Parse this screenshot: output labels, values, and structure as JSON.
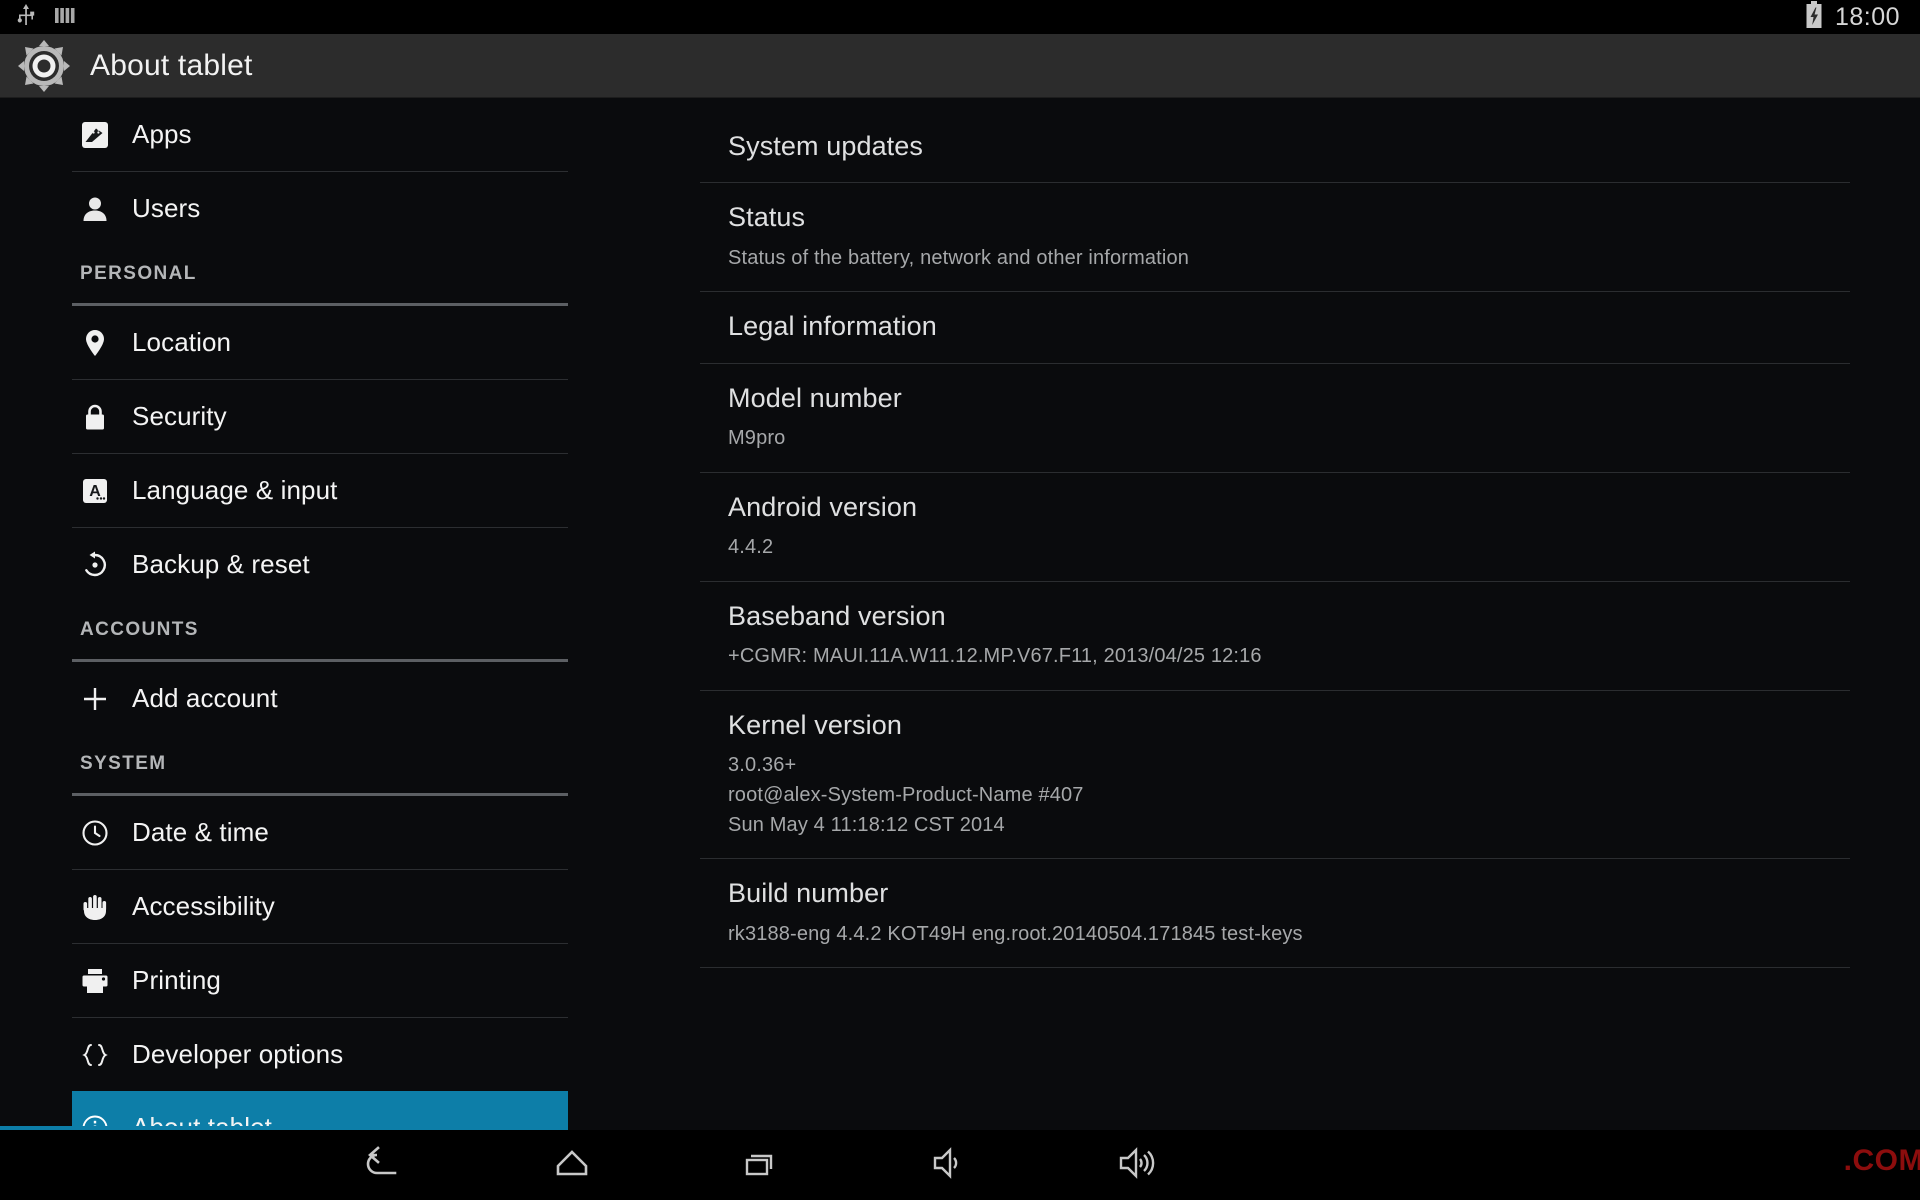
{
  "colors": {
    "accent": "#0d7ea8",
    "background": "#0a0b0d",
    "actionbar": "#2c2c2c",
    "statusbar": "#000000",
    "divider": "#2b2d30",
    "section_divider": "#5c5f63",
    "text_primary": "#f2f2f2",
    "text_secondary": "#a6a8aa",
    "watermark": "#8c0d0d"
  },
  "statusbar": {
    "left_icons": [
      "usb-icon",
      "signal-bars-icon"
    ],
    "right_icons": [
      "battery-charging-icon"
    ],
    "clock": "18:00"
  },
  "actionbar": {
    "icon": "settings-gear-icon",
    "title": "About tablet"
  },
  "sidebar": {
    "items": [
      {
        "type": "item",
        "label": "Apps",
        "icon": "apps-android-icon",
        "selected": false
      },
      {
        "type": "divider"
      },
      {
        "type": "item",
        "label": "Users",
        "icon": "user-person-icon",
        "selected": false
      },
      {
        "type": "section",
        "label": "PERSONAL"
      },
      {
        "type": "item",
        "label": "Location",
        "icon": "location-pin-icon",
        "selected": false
      },
      {
        "type": "divider"
      },
      {
        "type": "item",
        "label": "Security",
        "icon": "lock-icon",
        "selected": false
      },
      {
        "type": "divider"
      },
      {
        "type": "item",
        "label": "Language & input",
        "icon": "language-keyboard-icon",
        "selected": false
      },
      {
        "type": "divider"
      },
      {
        "type": "item",
        "label": "Backup & reset",
        "icon": "backup-restore-icon",
        "selected": false
      },
      {
        "type": "section",
        "label": "ACCOUNTS"
      },
      {
        "type": "item",
        "label": "Add account",
        "icon": "plus-icon",
        "selected": false
      },
      {
        "type": "section",
        "label": "SYSTEM"
      },
      {
        "type": "item",
        "label": "Date & time",
        "icon": "clock-icon",
        "selected": false
      },
      {
        "type": "divider"
      },
      {
        "type": "item",
        "label": "Accessibility",
        "icon": "hand-icon",
        "selected": false
      },
      {
        "type": "divider"
      },
      {
        "type": "item",
        "label": "Printing",
        "icon": "printer-icon",
        "selected": false
      },
      {
        "type": "divider"
      },
      {
        "type": "item",
        "label": "Developer options",
        "icon": "braces-icon",
        "selected": false
      },
      {
        "type": "item",
        "label": "About tablet",
        "icon": "info-circle-icon",
        "selected": true
      }
    ]
  },
  "main": {
    "items": [
      {
        "title": "System updates",
        "sub": ""
      },
      {
        "title": "Status",
        "sub": "Status of the battery, network and other information"
      },
      {
        "title": "Legal information",
        "sub": ""
      },
      {
        "title": "Model number",
        "sub": "M9pro"
      },
      {
        "title": "Android version",
        "sub": "4.4.2"
      },
      {
        "title": "Baseband version",
        "sub": "+CGMR: MAUI.11A.W11.12.MP.V67.F11, 2013/04/25 12:16"
      },
      {
        "title": "Kernel version",
        "sub": "3.0.36+\nroot@alex-System-Product-Name #407\nSun May 4 11:18:12 CST 2014"
      },
      {
        "title": "Build number",
        "sub": "rk3188-eng 4.4.2 KOT49H eng.root.20140504.171845 test-keys"
      }
    ]
  },
  "navbar": {
    "buttons": [
      {
        "name": "back-button",
        "icon": "back-arrow-icon"
      },
      {
        "name": "home-button",
        "icon": "home-icon"
      },
      {
        "name": "recents-button",
        "icon": "recents-icon"
      },
      {
        "name": "volume-down-button",
        "icon": "volume-low-icon"
      },
      {
        "name": "volume-up-button",
        "icon": "volume-high-icon"
      }
    ]
  },
  "watermark": {
    "text": ".COM"
  }
}
